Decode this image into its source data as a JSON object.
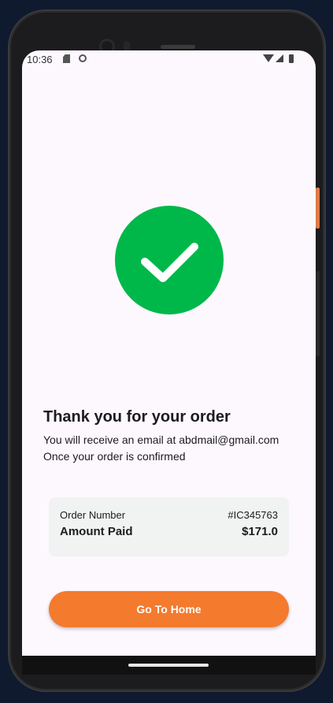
{
  "status_bar": {
    "time": "10:36"
  },
  "icons": {
    "success": "checkmark-circle-icon",
    "status_left": [
      "sd-card-icon",
      "face-icon"
    ],
    "status_right": [
      "wifi-icon",
      "signal-icon",
      "battery-icon"
    ]
  },
  "colors": {
    "success_green": "#00b84a",
    "button_orange": "#f47a2e",
    "background": "#fdf8fe",
    "card_background": "#f1f2f2"
  },
  "confirmation": {
    "title": "Thank you for your order",
    "email_message": "You will receive an email at abdmail@gmail.com",
    "confirm_message": "Once your order is confirmed"
  },
  "order_summary": {
    "order_number_label": "Order Number",
    "order_number_value": "#IC345763",
    "amount_paid_label": "Amount Paid",
    "amount_paid_value": "$171.0"
  },
  "actions": {
    "home_button_label": "Go To Home"
  }
}
